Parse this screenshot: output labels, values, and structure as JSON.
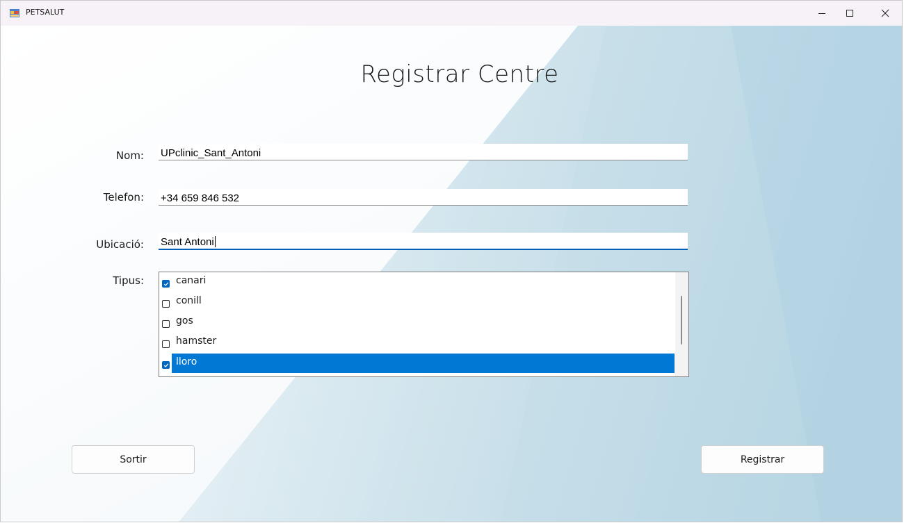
{
  "window": {
    "title": "PETSALUT",
    "icon": "form-icon",
    "controls": [
      "minimize-icon",
      "maximize-icon",
      "close-icon"
    ]
  },
  "page": {
    "title": "Registrar Centre"
  },
  "form": {
    "nom": {
      "label": "Nom:",
      "value": "UPclinic_Sant_Antoni"
    },
    "telefon": {
      "label": "Telefon:",
      "value": "+34 659 846 532"
    },
    "ubicacio": {
      "label": "Ubicació:",
      "value": "Sant Antoni"
    },
    "tipus": {
      "label": "Tipus:",
      "items": [
        {
          "label": "canari",
          "checked": true,
          "selected": false
        },
        {
          "label": "conill",
          "checked": false,
          "selected": false
        },
        {
          "label": "gos",
          "checked": false,
          "selected": false
        },
        {
          "label": "hamster",
          "checked": false,
          "selected": false
        },
        {
          "label": "lloro",
          "checked": true,
          "selected": true
        }
      ]
    }
  },
  "buttons": {
    "sortir": "Sortir",
    "registrar": "Registrar"
  },
  "colors": {
    "accent": "#0078d4",
    "checkbox_checked": "#0067c0",
    "background_light": "#fafcfe",
    "background_blue": "#b7d5e3"
  }
}
